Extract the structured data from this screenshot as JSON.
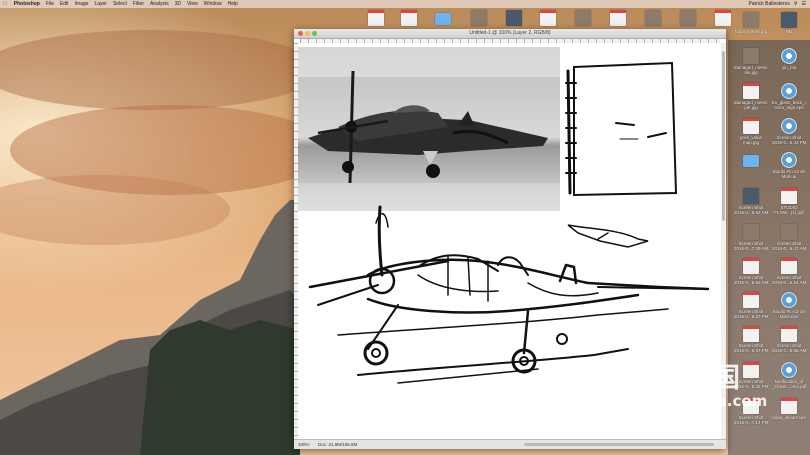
{
  "menubar": {
    "app_name": "Photoshop",
    "items": [
      "File",
      "Edit",
      "Image",
      "Layer",
      "Select",
      "Filter",
      "Analysis",
      "3D",
      "View",
      "Window",
      "Help"
    ],
    "user": "Patrick Ballesteros"
  },
  "photoshop": {
    "window_title": "Untitled-1 @ 100% (Layer 2, RGB/8)",
    "zoom": "100%",
    "doc_info": "Doc: 21.9M/156.5M"
  },
  "desktop_icons": [
    {
      "label1": "boba_lineart.jpg",
      "label2": "",
      "kind": "img"
    },
    {
      "label1": "HD",
      "label2": "",
      "kind": "dark"
    },
    {
      "label1": "damaged_meeso",
      "label2": "ani.jpg",
      "kind": "img"
    },
    {
      "label1": "yin_bla",
      "label2": "",
      "kind": "disk"
    },
    {
      "label1": "damaged_meeso",
      "label2": "pet.jpg",
      "kind": "pdf"
    },
    {
      "label1": "Ex_glass_back_v",
      "label2": "ector_sign.eps",
      "kind": "disk"
    },
    {
      "label1": "print_value",
      "label2": "map.jpg",
      "kind": "pdf"
    },
    {
      "label1": "Screen Shot",
      "label2": "2016-0...6.43 PM",
      "kind": "disk"
    },
    {
      "label1": "",
      "label2": "",
      "kind": "folder"
    },
    {
      "label1": "Studio Flo Circle",
      "label2": "Mark.ai",
      "kind": "disk"
    },
    {
      "label1": "Screen Shot",
      "label2": "2016-0...6.53 AM",
      "kind": "dark"
    },
    {
      "label1": "STUDIO",
      "label2": "FLOW...(1).pdf",
      "kind": "pdf"
    },
    {
      "label1": "Screen Shot",
      "label2": "2016-0...7.29 AM",
      "kind": "img"
    },
    {
      "label1": "Screen Shot",
      "label2": "2016-0...6.47 AM",
      "kind": "img"
    },
    {
      "label1": "Screen Shot",
      "label2": "2016-0...6.52 AM",
      "kind": "pdf"
    },
    {
      "label1": "Screen Shot",
      "label2": "2016-0...5.54 AM",
      "kind": "pdf"
    },
    {
      "label1": "Screen Shot",
      "label2": "2016-0...6.37 PM",
      "kind": "pdf"
    },
    {
      "label1": "Studio Flo Circle",
      "label2": "Mark.eps",
      "kind": "disk"
    },
    {
      "label1": "Screen Shot",
      "label2": "2016-0...6.37 PM",
      "kind": "pdf"
    },
    {
      "label1": "Screen Shot",
      "label2": "2016-0...5.55 AM",
      "kind": "pdf"
    },
    {
      "label1": "Screen Shot",
      "label2": "2016-0...6.32 PM",
      "kind": "pdf"
    },
    {
      "label1": "Notification_of",
      "label2": "_Ticket...orex.pdf",
      "kind": "disk"
    },
    {
      "label1": "Screen Shot",
      "label2": "2016-0...7.14 PM",
      "kind": "pdf"
    },
    {
      "label1": "boba_lineart.eps",
      "label2": "",
      "kind": "pdf"
    }
  ],
  "watermark": {
    "cn": "灵感中国",
    "en": "lingganchina.com"
  }
}
